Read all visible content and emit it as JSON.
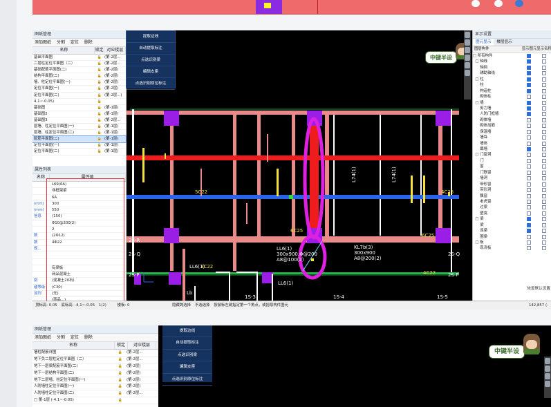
{
  "left_rail": {},
  "top_strip": {},
  "tree": {
    "title": "图纸管理",
    "toolbar": [
      "添加图纸",
      "分割",
      "定位",
      "删除"
    ],
    "columns": [
      "名称",
      "锁定",
      "对应楼层"
    ],
    "rows": [
      {
        "name": "基础平面图",
        "layer": "(第-2层..."
      },
      {
        "name": "二层柱定位平面图（二）",
        "layer": "(第-2层..."
      },
      {
        "name": "基础配筋平面图(二)",
        "layer": "(第-2层)"
      },
      {
        "name": "结构平面图(二)",
        "layer": "(第-2层)"
      },
      {
        "name": "墙、柱定位平面图(一)",
        "layer": "(第-2层)"
      },
      {
        "name": "定位平面图(一)",
        "layer": "(第-2层)"
      },
      {
        "name": "定位平面图(二)",
        "layer": "(第-2层...)"
      },
      {
        "name": "4.1~-0.05)",
        "layer": ""
      },
      {
        "name": "基础图",
        "layer": "(第-1层)"
      },
      {
        "name": "基础图2",
        "layer": "(第-1层)"
      },
      {
        "name": "基础图3",
        "layer": "(第-2层..."
      },
      {
        "name": "层墙、柱定位平面图(一)",
        "layer": "(第-1层)"
      },
      {
        "name": "层墙、柱定位平面图(二)",
        "layer": "(第-1层)"
      },
      {
        "name": "配筋平面图(二)",
        "layer": "(第-1层)",
        "selected": true
      },
      {
        "name": "定位平面图(一)",
        "layer": "(第-1层)"
      },
      {
        "name": "定位平面图(二)",
        "layer": "(第-1层)"
      }
    ]
  },
  "props": {
    "title": "属性列表",
    "col_name": "名称",
    "col_value": "属性值",
    "rows": [
      {
        "k": "",
        "v": "L69(6A)"
      },
      {
        "k": "",
        "v": "非框架梁"
      },
      {
        "k": "",
        "v": "6A"
      },
      {
        "k": "(mm)",
        "v": "300"
      },
      {
        "k": "(mm)",
        "v": "550"
      },
      {
        "k": "信息",
        "v": "(150)"
      },
      {
        "k": "",
        "v": "Φ10@200(2)"
      },
      {
        "k": "",
        "v": "2"
      },
      {
        "k": "数",
        "v": "(2Φ12)"
      },
      {
        "k": "数",
        "v": "4Φ22"
      },
      {
        "k": "规...",
        "v": ""
      },
      {
        "k": "",
        "v": ""
      },
      {
        "k": "",
        "v": ""
      },
      {
        "k": "",
        "v": "有梁板"
      },
      {
        "k": "",
        "v": "商品混凝土"
      },
      {
        "k": "别",
        "v": "(混凝土20石)"
      },
      {
        "k": "建等级",
        "v": "(C30)"
      },
      {
        "k": "加剂",
        "v": "(无)"
      },
      {
        "k": "",
        "v": "(商品...)"
      }
    ]
  },
  "status": {
    "items": [
      "顶标高: 0.05",
      "底标高: -4.1~-0.05",
      "1(2)",
      "楼板: 0",
      "隐藏跨选择",
      "不选选择",
      "按鼠标左键指定第一个角点，或拾取构件图元"
    ],
    "coord": "142,857 (-"
  },
  "menu": {
    "items": [
      "提取边线",
      "自动提取标注",
      "点选识别梁",
      "编辑支座",
      "点选识别原位标注"
    ]
  },
  "logo": {
    "text": "中键半设"
  },
  "cad_labels": {
    "axis_q": "2S-Q",
    "axis_p": "2S-P",
    "axis_r": "2S-R",
    "axis_3": "1S-3",
    "axis_4": "1S-4",
    "axis_5": "1S-5",
    "beam1": "LL6(1)",
    "beam1_size": "300x900,Φ@200",
    "beam1_rebar": "A8@100(2)",
    "beam2": "KL7b(3)",
    "beam2_size": "300x900",
    "beam2_rebar": "A8@200(2)",
    "ll6": "LL6(1)",
    "ll6b": "LL6(1)",
    "lb": "Lb",
    "c22a": "3C22",
    "c22b": "4C22",
    "c22c": "5C22",
    "c25": "6C25",
    "c25b": "4C25",
    "c25c": "6C25",
    "l74": "L74(1)",
    "l74b": "L74(1)"
  },
  "display": {
    "title": "显示设置",
    "tabs": [
      "图元显示",
      "楼层显示"
    ],
    "head": [
      "图层构件",
      "显示图元",
      "显示名称"
    ],
    "rows": [
      {
        "name": "□ 所有构件",
        "a": true,
        "b": false
      },
      {
        "name": "  □ 轴线",
        "a": true,
        "b": false
      },
      {
        "name": "      轴网",
        "a": true,
        "b": false
      },
      {
        "name": "      辅助轴线",
        "a": true,
        "b": false
      },
      {
        "name": "  □ 柱",
        "a": true,
        "b": false
      },
      {
        "name": "      柱",
        "a": true,
        "b": false
      },
      {
        "name": "      构造柱",
        "a": true,
        "b": false
      },
      {
        "name": "      砌体柱",
        "a": false,
        "b": false
      },
      {
        "name": "  □ 墙",
        "a": true,
        "b": false
      },
      {
        "name": "      剪力墙",
        "a": true,
        "b": false
      },
      {
        "name": "      人防门框墙",
        "a": true,
        "b": false
      },
      {
        "name": "      砌体墙",
        "a": false,
        "b": false
      },
      {
        "name": "      砌体加筋",
        "a": false,
        "b": false
      },
      {
        "name": "      保温墙",
        "a": false,
        "b": false
      },
      {
        "name": "      墙垛",
        "a": false,
        "b": false
      },
      {
        "name": "      墙体",
        "a": false,
        "b": false
      },
      {
        "name": "      幕墙",
        "a": true,
        "b": false
      },
      {
        "name": "  □ 门窗洞",
        "a": false,
        "b": false
      },
      {
        "name": "      门",
        "a": false,
        "b": false
      },
      {
        "name": "      窗",
        "a": false,
        "b": false
      },
      {
        "name": "      门联窗",
        "a": false,
        "b": false
      },
      {
        "name": "      墙洞",
        "a": false,
        "b": false
      },
      {
        "name": "      带形窗",
        "a": false,
        "b": false
      },
      {
        "name": "      带形洞",
        "a": false,
        "b": false
      },
      {
        "name": "      飘窗",
        "a": false,
        "b": false
      },
      {
        "name": "      老虎窗",
        "a": false,
        "b": false
      },
      {
        "name": "      过梁",
        "a": false,
        "b": false
      },
      {
        "name": "      壁龛",
        "a": false,
        "b": false
      },
      {
        "name": "  □ 梁",
        "a": true,
        "b": false
      },
      {
        "name": "      梁",
        "a": true,
        "b": false
      },
      {
        "name": "      连梁",
        "a": true,
        "b": false
      },
      {
        "name": "      圈梁",
        "a": false,
        "b": false
      },
      {
        "name": "  □ 板",
        "a": false,
        "b": false
      },
      {
        "name": "      现浇板",
        "a": false,
        "b": false
      }
    ],
    "footer": "恢复默认设置"
  },
  "tree2": {
    "title": "图纸管理",
    "toolbar": [
      "添加图纸",
      "分割",
      "定位",
      "删除"
    ],
    "columns": [
      "名称",
      "锁定",
      "对应楼层"
    ],
    "rows": [
      {
        "name": "墙柱配筋详图",
        "layer": "(第-2层..."
      },
      {
        "name": "地下负二层柱定位平面图（二）",
        "layer": "(第-2层..."
      },
      {
        "name": "地下一层梁配筋平面图(二)",
        "layer": "(第-2层)"
      },
      {
        "name": "地下一层结构平面图(二)",
        "layer": "(第-2层)"
      },
      {
        "name": "地下二层墙、柱定位平面图(一)",
        "layer": "(第-2层)"
      },
      {
        "name": "人防墙柱定位平面图(一)",
        "layer": "(第-2层)"
      },
      {
        "name": "人防墙柱定位平面图(二)",
        "layer": "(第-2层..."
      },
      {
        "name": "□ 第-1层 (-4.1~-0.05)",
        "layer": ""
      }
    ]
  },
  "menu2": {
    "items": [
      "提取边线",
      "自动提取标注",
      "点选识别梁",
      "编辑支座",
      "点选识别原位标注"
    ]
  }
}
